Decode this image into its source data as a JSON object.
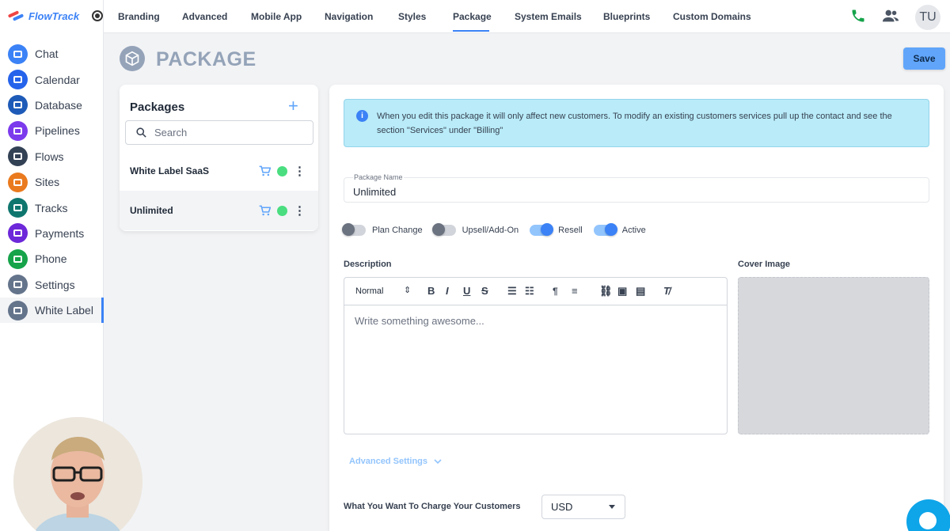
{
  "brand": {
    "name": "FlowTrack"
  },
  "sidebar": {
    "items": [
      {
        "label": "Chat",
        "icon": "chat-icon",
        "color": "#3b82f6"
      },
      {
        "label": "Calendar",
        "icon": "calendar-icon",
        "color": "#2563eb"
      },
      {
        "label": "Database",
        "icon": "database-icon",
        "color": "#1e5bb8"
      },
      {
        "label": "Pipelines",
        "icon": "pipelines-icon",
        "color": "#7c3aed"
      },
      {
        "label": "Flows",
        "icon": "flows-icon",
        "color": "#334155"
      },
      {
        "label": "Sites",
        "icon": "sites-icon",
        "color": "#ea7a1e"
      },
      {
        "label": "Tracks",
        "icon": "tracks-icon",
        "color": "#0f766e"
      },
      {
        "label": "Payments",
        "icon": "payments-icon",
        "color": "#6d28d9"
      },
      {
        "label": "Phone",
        "icon": "phone-icon",
        "color": "#16a34a"
      },
      {
        "label": "Settings",
        "icon": "gear-icon",
        "color": "#64748b"
      },
      {
        "label": "White Label",
        "icon": "white-label-icon",
        "color": "#64748b"
      }
    ],
    "active": "White Label"
  },
  "topnav": {
    "tabs": [
      "Branding",
      "Advanced",
      "Mobile App",
      "Navigation",
      "Styles",
      "Package",
      "System Emails",
      "Blueprints",
      "Custom Domains"
    ],
    "active": "Package",
    "avatar_initials": "TU"
  },
  "page": {
    "title": "PACKAGE",
    "save_label": "Save"
  },
  "packages": {
    "title": "Packages",
    "search_placeholder": "Search",
    "items": [
      {
        "name": "White Label SaaS",
        "status_color": "#4ade80"
      },
      {
        "name": "Unlimited",
        "status_color": "#4ade80",
        "selected": true
      }
    ]
  },
  "form": {
    "info_text": "When you edit this package it will only affect new customers. To modify an existing customers services pull up the contact and see the section \"Services\" under \"Billing\"",
    "package_name_label": "Package Name",
    "package_name_value": "Unlimited",
    "toggles": [
      {
        "label": "Plan Change",
        "on": false
      },
      {
        "label": "Upsell/Add-On",
        "on": false
      },
      {
        "label": "Resell",
        "on": true
      },
      {
        "label": "Active",
        "on": true
      }
    ],
    "description_label": "Description",
    "cover_image_label": "Cover Image",
    "editor_format": "Normal",
    "editor_placeholder": "Write something awesome...",
    "advanced_settings": "Advanced Settings",
    "charge_label": "What You Want To Charge Your Customers",
    "currency": "USD"
  },
  "colors": {
    "accent": "#3b82f6",
    "info_bg": "#b9ebf8",
    "save_bg": "#60a5fa"
  }
}
